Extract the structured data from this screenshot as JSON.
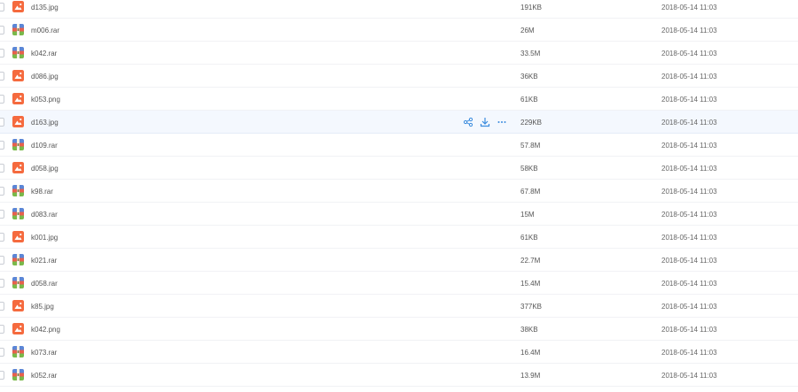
{
  "files": [
    {
      "name": "d135.jpg",
      "type": "image",
      "icon": "image-file-icon",
      "size": "191KB",
      "date": "2018-05-14 11:03"
    },
    {
      "name": "m006.rar",
      "type": "archive",
      "icon": "archive-file-icon",
      "size": "26M",
      "date": "2018-05-14 11:03"
    },
    {
      "name": "k042.rar",
      "type": "archive",
      "icon": "archive-file-icon",
      "size": "33.5M",
      "date": "2018-05-14 11:03"
    },
    {
      "name": "d086.jpg",
      "type": "image",
      "icon": "image-file-icon",
      "size": "36KB",
      "date": "2018-05-14 11:03"
    },
    {
      "name": "k053.png",
      "type": "image",
      "icon": "image-file-icon",
      "size": "61KB",
      "date": "2018-05-14 11:03"
    },
    {
      "name": "d163.jpg",
      "type": "image",
      "icon": "image-file-icon",
      "size": "229KB",
      "date": "2018-05-14 11:03",
      "hovered": true
    },
    {
      "name": "d109.rar",
      "type": "archive",
      "icon": "archive-file-icon",
      "size": "57.8M",
      "date": "2018-05-14 11:03"
    },
    {
      "name": "d058.jpg",
      "type": "image",
      "icon": "image-file-icon",
      "size": "58KB",
      "date": "2018-05-14 11:03"
    },
    {
      "name": "k98.rar",
      "type": "archive",
      "icon": "archive-file-icon",
      "size": "67.8M",
      "date": "2018-05-14 11:03"
    },
    {
      "name": "d083.rar",
      "type": "archive",
      "icon": "archive-file-icon",
      "size": "15M",
      "date": "2018-05-14 11:03"
    },
    {
      "name": "k001.jpg",
      "type": "image",
      "icon": "image-file-icon",
      "size": "61KB",
      "date": "2018-05-14 11:03"
    },
    {
      "name": "k021.rar",
      "type": "archive",
      "icon": "archive-file-icon",
      "size": "22.7M",
      "date": "2018-05-14 11:03"
    },
    {
      "name": "d058.rar",
      "type": "archive",
      "icon": "archive-file-icon",
      "size": "15.4M",
      "date": "2018-05-14 11:03"
    },
    {
      "name": "k85.jpg",
      "type": "image",
      "icon": "image-file-icon",
      "size": "377KB",
      "date": "2018-05-14 11:03"
    },
    {
      "name": "k042.png",
      "type": "image",
      "icon": "image-file-icon",
      "size": "38KB",
      "date": "2018-05-14 11:03"
    },
    {
      "name": "k073.rar",
      "type": "archive",
      "icon": "archive-file-icon",
      "size": "16.4M",
      "date": "2018-05-14 11:03"
    },
    {
      "name": "k052.rar",
      "type": "archive",
      "icon": "archive-file-icon",
      "size": "13.9M",
      "date": "2018-05-14 11:03"
    }
  ],
  "row_actions": [
    {
      "name": "share",
      "icon": "share-icon"
    },
    {
      "name": "download",
      "icon": "download-icon"
    },
    {
      "name": "more",
      "icon": "more-icon"
    }
  ],
  "colors": {
    "image_icon": "#f56a3e",
    "archive_blue": "#5b86d6",
    "archive_green": "#79b94b",
    "archive_red": "#e8604c",
    "action_blue": "#3b8cde",
    "hover_row": "#f4f8fe"
  }
}
